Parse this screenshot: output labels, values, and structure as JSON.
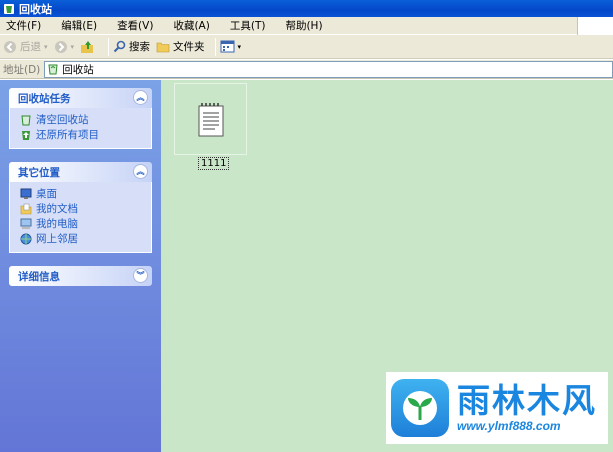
{
  "window": {
    "title": "回收站"
  },
  "menu": [
    {
      "label": "文件(F)"
    },
    {
      "label": "编辑(E)"
    },
    {
      "label": "查看(V)"
    },
    {
      "label": "收藏(A)"
    },
    {
      "label": "工具(T)"
    },
    {
      "label": "帮助(H)"
    }
  ],
  "toolbar": {
    "back": "后退",
    "search": "搜索",
    "folders": "文件夹"
  },
  "address": {
    "label": "地址(D)",
    "value": "回收站"
  },
  "tasks_panel": {
    "title": "回收站任务",
    "items": [
      {
        "label": "清空回收站"
      },
      {
        "label": "还原所有项目"
      }
    ]
  },
  "places_panel": {
    "title": "其它位置",
    "items": [
      {
        "label": "桌面"
      },
      {
        "label": "我的文档"
      },
      {
        "label": "我的电脑"
      },
      {
        "label": "网上邻居"
      }
    ]
  },
  "details_panel": {
    "title": "详细信息"
  },
  "files": [
    {
      "name": "1111",
      "icon": "notepad-file-icon"
    }
  ],
  "watermark": {
    "text": "雨林木风",
    "url": "www.ylmf888.com"
  },
  "colors": {
    "titlebar": "#0a5fd8",
    "leftpane": "#7ba2e7",
    "content": "#c9e6c9",
    "accent": "#215dc6"
  }
}
